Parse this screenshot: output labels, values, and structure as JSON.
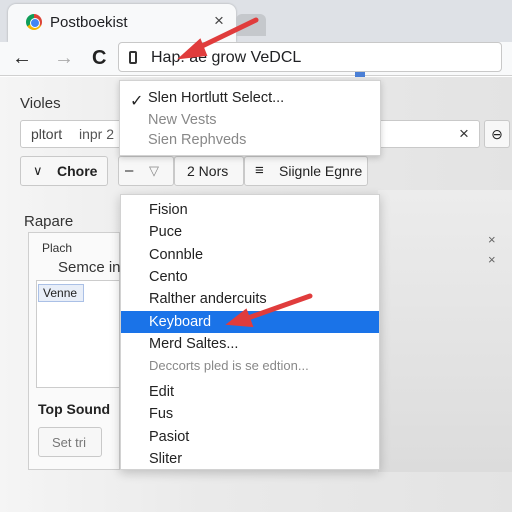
{
  "browser": {
    "tab_title": "Postboekist",
    "tab_close": "×",
    "back_icon": "←",
    "forward_icon": "→",
    "reload_icon": "C",
    "address_text": "Hap. ae grow VeDCL"
  },
  "page": {
    "heading_1": "Violes",
    "search_left": "pltort",
    "search_middle": "inpr 2",
    "search_clear": "×",
    "right_icon": "⊖",
    "chore_button": "Chore",
    "chore_chevron": "∨",
    "minus_btn": "–",
    "filter_icon": "▽",
    "nors_button": "2 Nors",
    "menu_icon": "≡",
    "signle_button": "Siignle Egnre",
    "rapare_label": "Rapare",
    "plach_label": "Plach",
    "semce_text": "Semce in",
    "venne_chip": "Venne",
    "top_sound": "Top Sound",
    "set_button": "Set tri",
    "right_x1": "×",
    "right_x2": "×"
  },
  "top_dropdown": {
    "check": "✓",
    "items": [
      {
        "label": "Slen Hortlutt Select...",
        "dim": false
      },
      {
        "label": "New Vests",
        "dim": true
      },
      {
        "label": "Sien Rephveds",
        "dim": true
      }
    ]
  },
  "big_dropdown": {
    "items": [
      {
        "label": "Fision"
      },
      {
        "label": "Puce"
      },
      {
        "label": "Connble"
      },
      {
        "label": "Cento"
      },
      {
        "label": "Ralther andercuits"
      },
      {
        "label": "Keyboard",
        "selected": true
      },
      {
        "label": "Merd Saltes..."
      },
      {
        "label": "Deccorts pled is se edtion...",
        "dim": true
      },
      {
        "label": "Edit"
      },
      {
        "label": "Fus"
      },
      {
        "label": "Pasiot"
      },
      {
        "label": "Sliter"
      }
    ]
  },
  "colors": {
    "accent": "#1a73e8",
    "annotation_arrow": "#e03c3c"
  }
}
